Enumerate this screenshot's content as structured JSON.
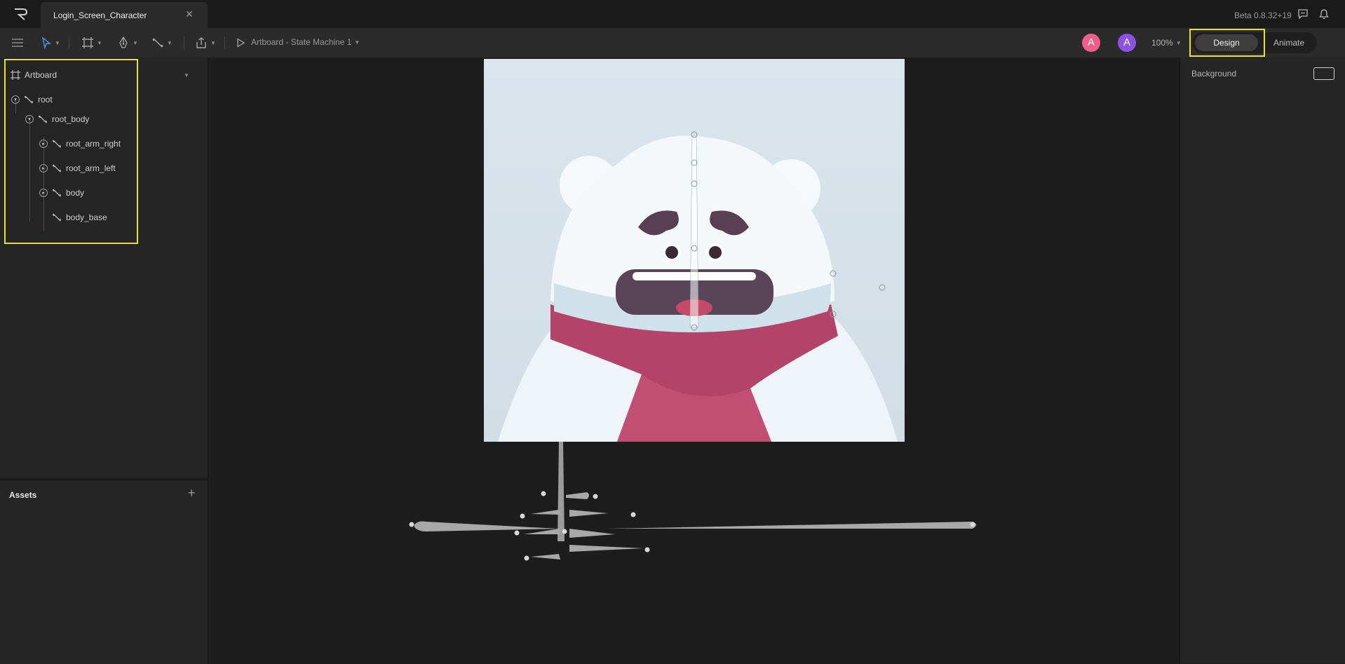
{
  "titlebar": {
    "document_tab": "Login_Screen_Character",
    "version": "Beta 0.8.32+19"
  },
  "toolbar": {
    "state_machine_label": "Artboard - State Machine 1",
    "zoom": "100%",
    "avatars": [
      {
        "initial": "A",
        "color": "#ef5e8a"
      },
      {
        "initial": "A",
        "color": "#8b52e6"
      }
    ],
    "design_label": "Design",
    "animate_label": "Animate",
    "highlight_color": "#e8e02a"
  },
  "hierarchy": {
    "artboard_label": "Artboard",
    "items": [
      {
        "label": "root",
        "toggle": "open"
      },
      {
        "label": "root_body",
        "toggle": "open"
      },
      {
        "label": "root_arm_right",
        "toggle": "closed"
      },
      {
        "label": "root_arm_left",
        "toggle": "closed"
      },
      {
        "label": "body",
        "toggle": "closed"
      },
      {
        "label": "body_base",
        "toggle": "none"
      }
    ]
  },
  "assets": {
    "title": "Assets"
  },
  "inspector": {
    "background_label": "Background"
  },
  "colors": {
    "accent_highlight": "#e8e02a",
    "scarf": "#b4436a",
    "fur": "#f4f8fb",
    "artboard_bg": "#d6e1ea"
  }
}
